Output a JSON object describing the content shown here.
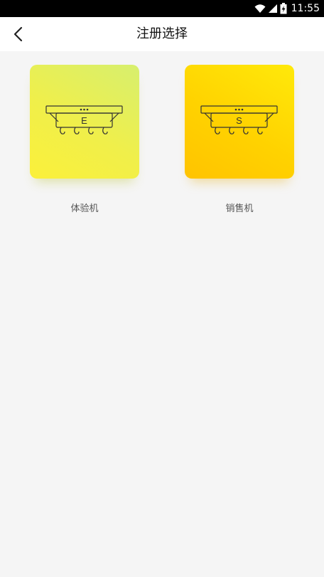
{
  "status_bar": {
    "time": "11:55",
    "icons": [
      "wifi-icon",
      "signal-icon",
      "battery-icon"
    ]
  },
  "header": {
    "back_icon": "chevron-left-icon",
    "title": "注册选择"
  },
  "options": [
    {
      "letter": "E",
      "label": "体验机",
      "icon": "machine-icon",
      "gradient": [
        "#d7ef6e",
        "#fbf03a"
      ]
    },
    {
      "letter": "S",
      "label": "销售机",
      "icon": "machine-icon",
      "gradient": [
        "#ffe90a",
        "#ffc300"
      ]
    }
  ],
  "colors": {
    "background": "#f5f5f5",
    "header": "#ffffff",
    "status_bar": "#000000",
    "line_art": "#333333"
  }
}
